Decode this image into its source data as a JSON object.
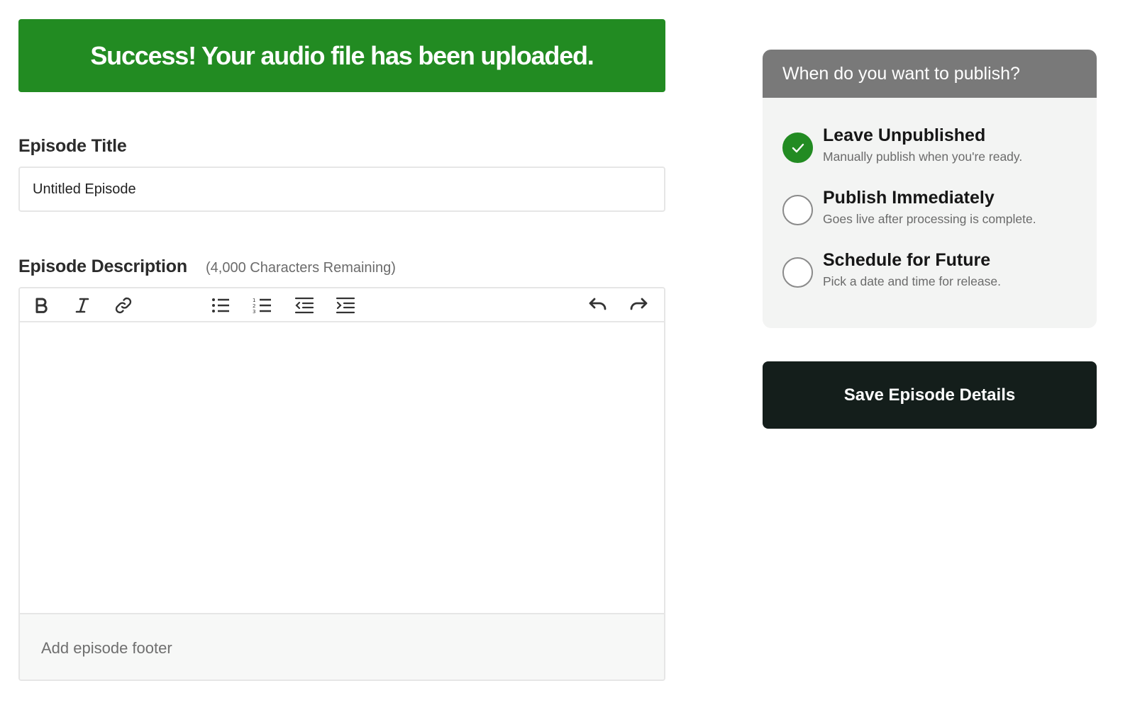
{
  "banner": {
    "message": "Success! Your audio file has been uploaded.",
    "color": "#228b22"
  },
  "title_field": {
    "label": "Episode Title",
    "value": "Untitled Episode",
    "placeholder": ""
  },
  "description_field": {
    "label": "Episode Description",
    "hint": "(4,000 Characters Remaining)",
    "value": "",
    "toolbar": [
      "bold-icon",
      "italic-icon",
      "link-icon",
      "bulleted-list-icon",
      "numbered-list-icon",
      "outdent-icon",
      "indent-icon",
      "undo-icon",
      "redo-icon"
    ],
    "footer_placeholder": "Add episode footer"
  },
  "publish": {
    "heading": "When do you want to publish?",
    "selected": 0,
    "options": [
      {
        "title": "Leave Unpublished",
        "subtitle": "Manually publish when you're ready."
      },
      {
        "title": "Publish Immediately",
        "subtitle": "Goes live after processing is complete."
      },
      {
        "title": "Schedule for Future",
        "subtitle": "Pick a date and time for release."
      }
    ]
  },
  "save_button": {
    "label": "Save Episode Details",
    "color": "#141e1b"
  }
}
